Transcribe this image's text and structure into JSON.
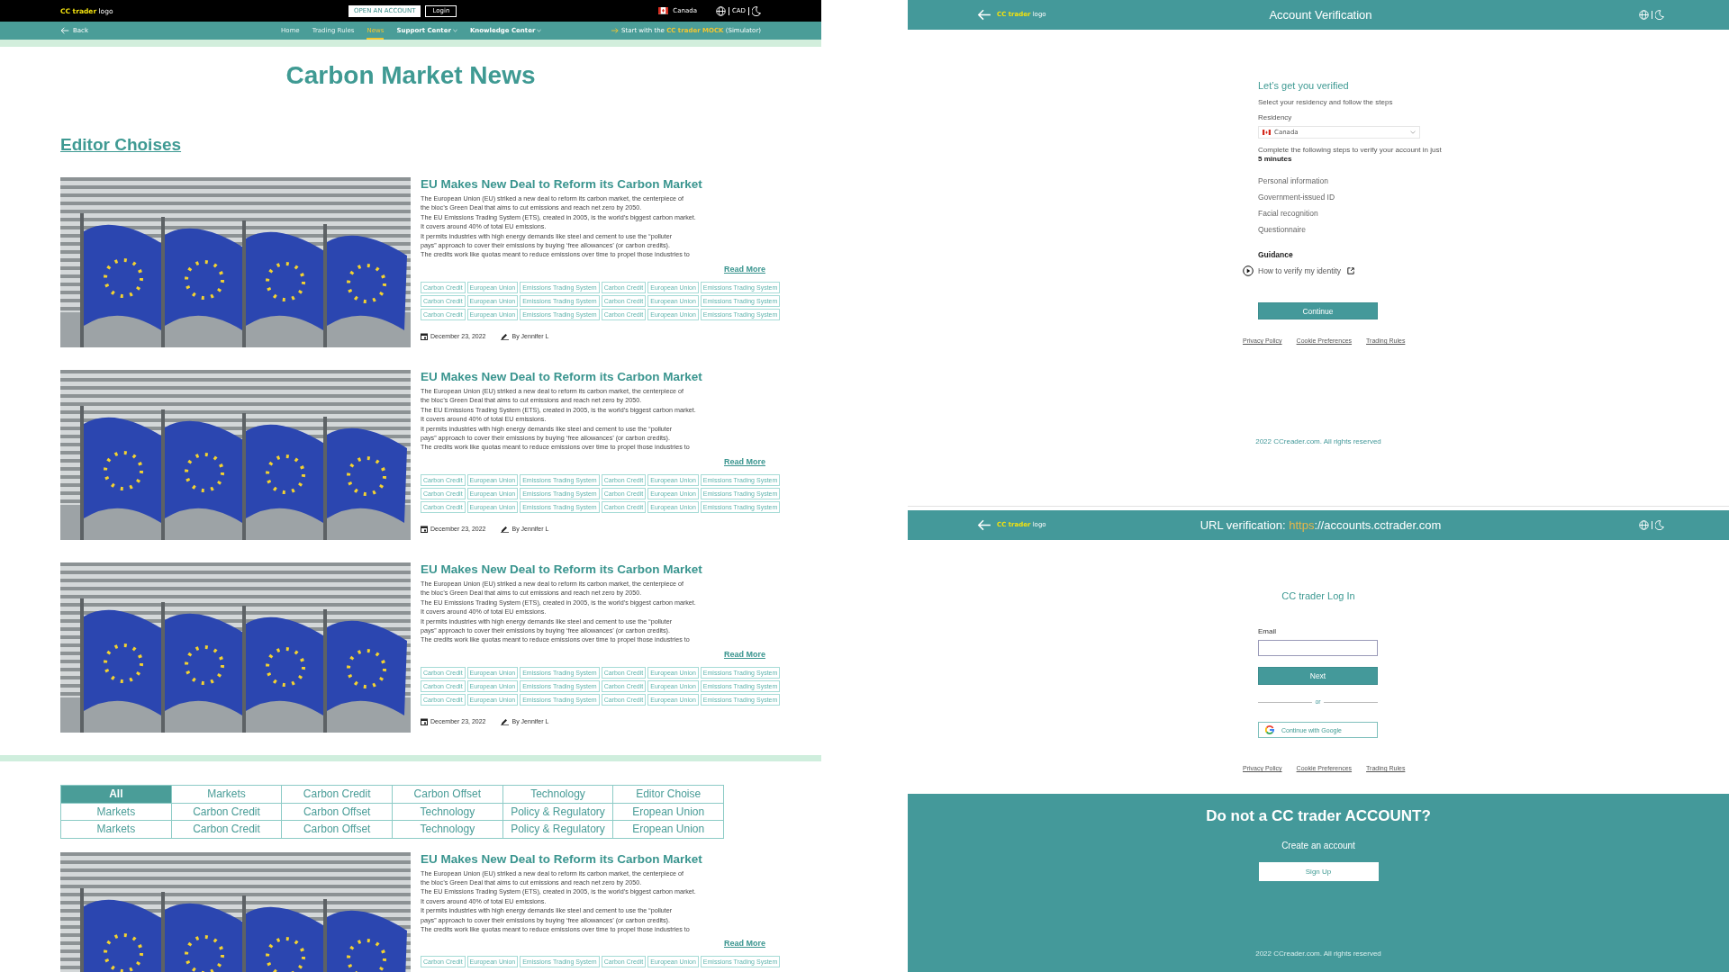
{
  "site_header": {
    "logo": "**CC trader** logo",
    "open_account": "OPEN AN ACCOUNT",
    "login": "Login",
    "country": "Canada",
    "currency": "CAD"
  },
  "nav": {
    "back": "Back",
    "items": [
      {
        "label": "Home",
        "kind": "link",
        "selected": false
      },
      {
        "label": "Trading Rules",
        "kind": "link",
        "selected": false
      },
      {
        "label": "News",
        "kind": "link",
        "selected": true
      },
      {
        "label": "Support Center",
        "kind": "menu",
        "selected": false
      },
      {
        "label": "Knowledge Center",
        "kind": "menu",
        "selected": false
      }
    ],
    "cta": "Start with the **CC trader MOCK** (Simulator)"
  },
  "page_title": "Carbon Market News",
  "section_title": "Editor Choises",
  "articles": [
    {
      "title": "EU Makes New Deal to Reform its Carbon Market",
      "body": [
        "The European Union (EU) striked a new deal to reform its carbon market, the centerpiece of",
        "the bloc’s Green Deal that aims to cut emissions and reach net zero by 2050.",
        "The EU Emissions Trading System (ETS), created in 2005, is the world’s biggest carbon market.",
        "It covers around 40% of total EU emissions.",
        "It permits industries with high energy demands like steel and cement to use the “polluter",
        "pays” approach to cover their emissions by buying ‘free allowances’ (or carbon credits).",
        "The credits work like quotas meant to reduce emissions over time to propel those industries to"
      ],
      "read_more": "Read More",
      "tags": [
        [
          "Carbon Credit",
          "European Union",
          "Emissions Trading System",
          "Carbon Credit",
          "European Union",
          "Emissions Trading System"
        ],
        [
          "Carbon Credit",
          "European Union",
          "Emissions Trading System",
          "Carbon Credit",
          "European Union",
          "Emissions Trading System"
        ],
        [
          "Carbon Credit",
          "European Union",
          "Emissions Trading System",
          "Carbon Credit",
          "European Union",
          "Emissions Trading System"
        ]
      ],
      "date": "December 23, 2022",
      "author": "By Jennifer L"
    },
    {
      "title": "EU Makes New Deal to Reform its Carbon Market",
      "body": [
        "The European Union (EU) striked a new deal to reform its carbon market, the centerpiece of",
        "the bloc’s Green Deal that aims to cut emissions and reach net zero by 2050.",
        "The EU Emissions Trading System (ETS), created in 2005, is the world’s biggest carbon market.",
        "It covers around 40% of total EU emissions.",
        "It permits industries with high energy demands like steel and cement to use the “polluter",
        "pays” approach to cover their emissions by buying ‘free allowances’ (or carbon credits).",
        "The credits work like quotas meant to reduce emissions over time to propel those industries to"
      ],
      "read_more": "Read More",
      "tags": [
        [
          "Carbon Credit",
          "European Union",
          "Emissions Trading System",
          "Carbon Credit",
          "European Union",
          "Emissions Trading System"
        ],
        [
          "Carbon Credit",
          "European Union",
          "Emissions Trading System",
          "Carbon Credit",
          "European Union",
          "Emissions Trading System"
        ],
        [
          "Carbon Credit",
          "European Union",
          "Emissions Trading System",
          "Carbon Credit",
          "European Union",
          "Emissions Trading System"
        ]
      ],
      "date": "December 23, 2022",
      "author": "By Jennifer L"
    },
    {
      "title": "EU Makes New Deal to Reform its Carbon Market",
      "body": [
        "The European Union (EU) striked a new deal to reform its carbon market, the centerpiece of",
        "the bloc’s Green Deal that aims to cut emissions and reach net zero by 2050.",
        "The EU Emissions Trading System (ETS), created in 2005, is the world’s biggest carbon market.",
        "It covers around 40% of total EU emissions.",
        "It permits industries with high energy demands like steel and cement to use the “polluter",
        "pays” approach to cover their emissions by buying ‘free allowances’ (or carbon credits).",
        "The credits work like quotas meant to reduce emissions over time to propel those industries to"
      ],
      "read_more": "Read More",
      "tags": [
        [
          "Carbon Credit",
          "European Union",
          "Emissions Trading System",
          "Carbon Credit",
          "European Union",
          "Emissions Trading System"
        ],
        [
          "Carbon Credit",
          "European Union",
          "Emissions Trading System",
          "Carbon Credit",
          "European Union",
          "Emissions Trading System"
        ],
        [
          "Carbon Credit",
          "European Union",
          "Emissions Trading System",
          "Carbon Credit",
          "European Union",
          "Emissions Trading System"
        ]
      ],
      "date": "December 23, 2022",
      "author": "By Jennifer L"
    }
  ],
  "filters": [
    [
      {
        "label": "All",
        "selected": true
      },
      {
        "label": "Markets",
        "selected": false
      },
      {
        "label": "Carbon Credit",
        "selected": false
      },
      {
        "label": "Carbon Offset",
        "selected": false
      },
      {
        "label": "Technology",
        "selected": false
      },
      {
        "label": "Editor Choise",
        "selected": false
      }
    ],
    [
      {
        "label": "Markets",
        "selected": false
      },
      {
        "label": "Carbon Credit",
        "selected": false
      },
      {
        "label": "Carbon Offset",
        "selected": false
      },
      {
        "label": "Technology",
        "selected": false
      },
      {
        "label": "Policy & Regulatory",
        "selected": false
      },
      {
        "label": "Eropean Union",
        "selected": false
      }
    ],
    [
      {
        "label": "Markets",
        "selected": false
      },
      {
        "label": "Carbon Credit",
        "selected": false
      },
      {
        "label": "Carbon Offset",
        "selected": false
      },
      {
        "label": "Technology",
        "selected": false
      },
      {
        "label": "Policy & Regulatory",
        "selected": false
      },
      {
        "label": "Eropean Union",
        "selected": false
      }
    ]
  ],
  "more_articles": [
    {
      "title": "EU Makes New Deal to Reform its Carbon Market",
      "body": [
        "The European Union (EU) striked a new deal to reform its carbon market, the centerpiece of",
        "the bloc’s Green Deal that aims to cut emissions and reach net zero by 2050.",
        "The EU Emissions Trading System (ETS), created in 2005, is the world’s biggest carbon market.",
        "It covers around 40% of total EU emissions.",
        "It permits industries with high energy demands like steel and cement to use the “polluter",
        "pays” approach to cover their emissions by buying ‘free allowances’ (or carbon credits).",
        "The credits work like quotas meant to reduce emissions over time to propel those industries to"
      ],
      "read_more": "Read More",
      "tags": [
        [
          "Carbon Credit",
          "European Union",
          "Emissions Trading System",
          "Carbon Credit",
          "European Union",
          "Emissions Trading System"
        ]
      ]
    }
  ],
  "verification": {
    "logo": "**CC trader** logo",
    "title": "Account Verification",
    "heading": "Let’s get you verified",
    "intro": "Select your residency and follow the steps",
    "residency_label": "Residency",
    "residency_value": "Canada",
    "steps_intro": "Complete the following steps to verify your account in just **5 minutes**",
    "steps": [
      "Personal information",
      "Government-issued ID",
      "Facial recognition",
      "Questionnaire"
    ],
    "guidance_title": "Guidance",
    "guidance_link": "How to verify my identity",
    "continue": "Continue",
    "footer_links": [
      "Privacy Policy",
      "Cookie Preferences",
      "Trading Rules"
    ],
    "copyright": "2022 CCreader.com. All rights reserved"
  },
  "login": {
    "logo": "**CC trader** logo",
    "title": {
      "label": "URL verification:",
      "scheme": "https",
      "rest": "://accounts.cctrader.com"
    },
    "heading": "CC trader Log In",
    "email_label": "Email",
    "next": "Next",
    "divider": "or",
    "google": "Continue with Google",
    "footer_links": [
      "Privacy Policy",
      "Cookie Preferences",
      "Trading Rules"
    ]
  },
  "signup": {
    "heading": "Do not a CC trader ACCOUNT?",
    "text": "Create an account",
    "button": "Sign Up",
    "copyright": "2022 CCreader.com. All rights reserved"
  }
}
